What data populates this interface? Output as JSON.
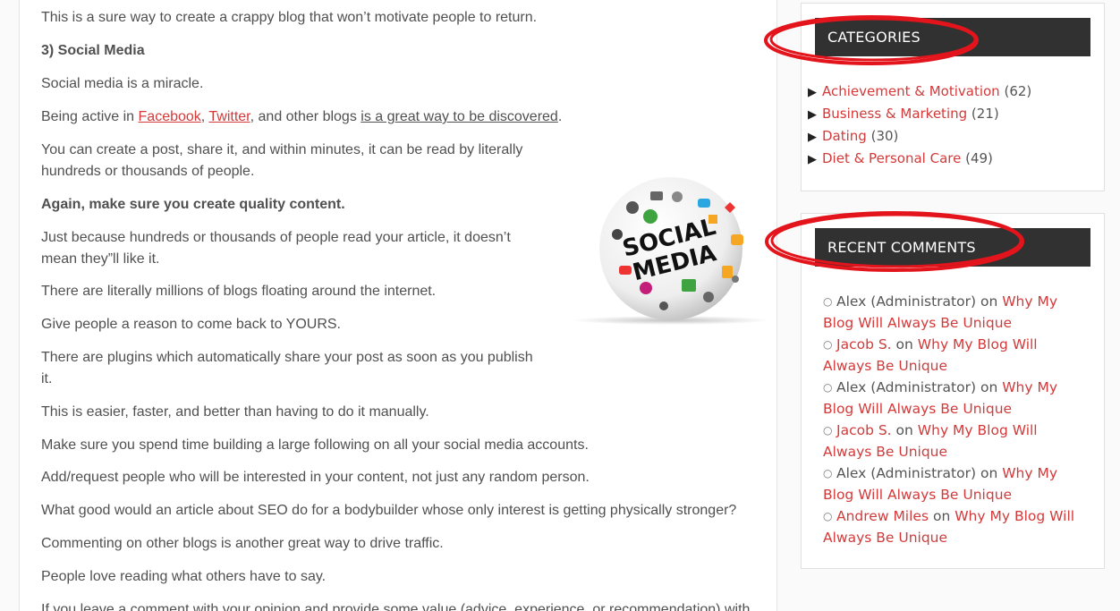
{
  "article": {
    "p1": "This is a sure way to create a crappy blog that won’t motivate people to return.",
    "heading": "3) Social Media",
    "p2": "Social media is a miracle.",
    "p3_prefix": "Being active in ",
    "p3_link1": "Facebook",
    "p3_sep": ", ",
    "p3_link2": "Twitter",
    "p3_mid": ", and other blogs ",
    "p3_link3": "is a great way to be discovered",
    "p3_end": ".",
    "p4_line1": "You can create a post, share it, and within minutes, it can be read by literally",
    "p4_line2": "hundreds or thousands of people.",
    "p5": "Again, make sure you create quality content.",
    "p6_line1": "Just because hundreds or thousands of people read your article, it doesn’t",
    "p6_line2": "mean they”ll like it.",
    "p7": "There are literally millions of blogs floating around the internet.",
    "p8": "Give people a reason to come back to YOURS.",
    "p9_line1": "There are plugins which automatically share your post as soon as you publish",
    "p9_line2": "it.",
    "p10": "This is easier, faster, and better than having to do it manually.",
    "p11": "Make sure you spend time building a large following on all your social media accounts.",
    "p12": "Add/request people who will be interested in your content, not just any random person.",
    "p13": "What good would an article about SEO do for a bodybuilder whose only interest is getting physically stronger?",
    "p14": "Commenting on other blogs is another great way to drive traffic.",
    "p15": "People love reading what others have to say.",
    "p16": "If you leave a comment with your opinion and provide some value (advice, experience, or recommendation) with",
    "image": {
      "line1": "SOCIAL",
      "line2": "MEDIA"
    }
  },
  "sidebar": {
    "categories": {
      "title": "CATEGORIES",
      "items": [
        {
          "name": "Achievement & Motivation",
          "count": "(62)"
        },
        {
          "name": "Business & Marketing",
          "count": "(21)"
        },
        {
          "name": "Dating",
          "count": "(30)"
        },
        {
          "name": "Diet & Personal Care",
          "count": "(49)"
        }
      ]
    },
    "recent_comments": {
      "title": "RECENT COMMENTS",
      "on": "on",
      "items": [
        {
          "author": "Alex (Administrator)",
          "post": "Why My Blog Will Always Be Unique"
        },
        {
          "author": "Jacob S.",
          "post": "Why My Blog Will Always Be Unique"
        },
        {
          "author": "Alex (Administrator)",
          "post": "Why My Blog Will Always Be Unique"
        },
        {
          "author": "Jacob S.",
          "post": "Why My Blog Will Always Be Unique"
        },
        {
          "author": "Alex (Administrator)",
          "post": "Why My Blog Will Always Be Unique"
        },
        {
          "author": "Andrew Miles",
          "post": "Why My Blog Will Always Be Unique"
        }
      ]
    }
  },
  "colors": {
    "link": "#d33a3a",
    "widget_header": "#313131",
    "annotation": "#e3141b"
  }
}
